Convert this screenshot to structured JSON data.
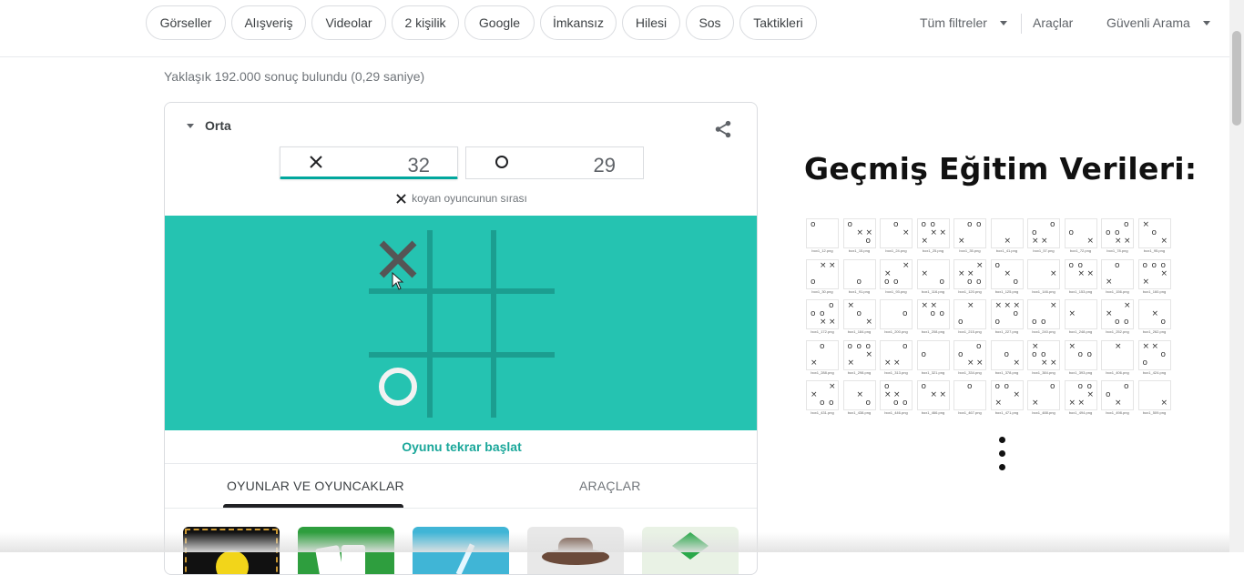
{
  "chips": [
    "Görseller",
    "Alışveriş",
    "Videolar",
    "2 kişilik",
    "Google",
    "İmkansız",
    "Hilesi",
    "Sos",
    "Taktikleri"
  ],
  "tools": {
    "all_filters": "Tüm filtreler",
    "tools": "Araçlar",
    "safe_search": "Güvenli Arama"
  },
  "result_stats": "Yaklaşık 192.000 sonuç bulundu (0,29 saniye)",
  "game": {
    "difficulty": "Orta",
    "score_x": "32",
    "score_o": "29",
    "turn_text": "koyan oyuncunun sırası",
    "board": [
      "X",
      "",
      "",
      "",
      "",
      "",
      "O",
      "",
      ""
    ],
    "restart": "Oyunu tekrar başlat",
    "accent": "#25c3b1"
  },
  "tabs": {
    "games": "OYUNLAR VE OYUNCAKLAR",
    "tools": "ARAÇLAR"
  },
  "right": {
    "heading": "Geçmiş Eğitim Verileri:",
    "grid_captions": [
      [
        "box1_12.png",
        "box1_15.png",
        "box1_24.png",
        "box1_25.png",
        "box1_35.png",
        "box1_41.png",
        "box1_57.png",
        "box1_72.png",
        "box1_78.png",
        "box1_95.png"
      ],
      [
        "box1_30.png",
        "box1_91.png",
        "box1_93.png",
        "box1_116.png",
        "box1_120.png",
        "box1_125.png",
        "box1_146.png",
        "box1_153.png",
        "box1_156.png",
        "box1_160.png"
      ],
      [
        "box1_172.png",
        "box1_184.png",
        "box1_200.png",
        "box1_208.png",
        "box1_215.png",
        "box1_227.png",
        "box1_240.png",
        "box1_248.png",
        "box1_252.png",
        "box1_262.png"
      ],
      [
        "box1_288.png",
        "box1_298.png",
        "box1_313.png",
        "box1_321.png",
        "box1_334.png",
        "box1_378.png",
        "box1_384.png",
        "box1_393.png",
        "box1_406.png",
        "box1_424.png"
      ],
      [
        "box1_431.png",
        "box1_438.png",
        "box1_446.png",
        "box1_466.png",
        "box1_467.png",
        "box1_471.png",
        "box1_488.png",
        "box1_494.png",
        "box1_498.png",
        "box1_509.png"
      ]
    ]
  }
}
